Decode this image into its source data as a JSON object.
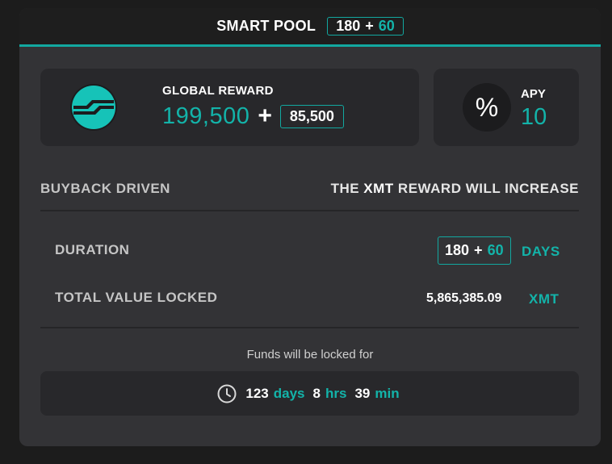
{
  "header": {
    "title": "SMART POOL",
    "duration_base": "180",
    "plus": "+",
    "duration_bonus": "60"
  },
  "reward": {
    "label": "GLOBAL REWARD",
    "main_value": "199,500",
    "plus": "+",
    "bonus_value": "85,500",
    "logo_icon": "xmt-token-icon"
  },
  "apy": {
    "icon": "percent-icon",
    "icon_glyph": "%",
    "label": "APY",
    "value": "10"
  },
  "info": {
    "buyback_label": "BUYBACK DRIVEN",
    "increase_prefix": "THE",
    "increase_token": "XMT",
    "increase_suffix": "REWARD WILL INCREASE"
  },
  "duration": {
    "label": "DURATION",
    "base": "180",
    "plus": "+",
    "bonus": "60",
    "unit": "DAYS"
  },
  "tvl": {
    "label": "TOTAL VALUE LOCKED",
    "value": "5,865,385.09",
    "unit": "XMT"
  },
  "lock": {
    "text": "Funds will be locked for",
    "days": "123",
    "days_unit": "days",
    "hrs": "8",
    "hrs_unit": "hrs",
    "min": "39",
    "min_unit": "min",
    "icon": "clock-icon"
  },
  "colors": {
    "accent": "#13b3a9",
    "card": "#333336",
    "panel": "#28282b",
    "header": "#1e1e1e",
    "background": "#1c1c1c"
  }
}
